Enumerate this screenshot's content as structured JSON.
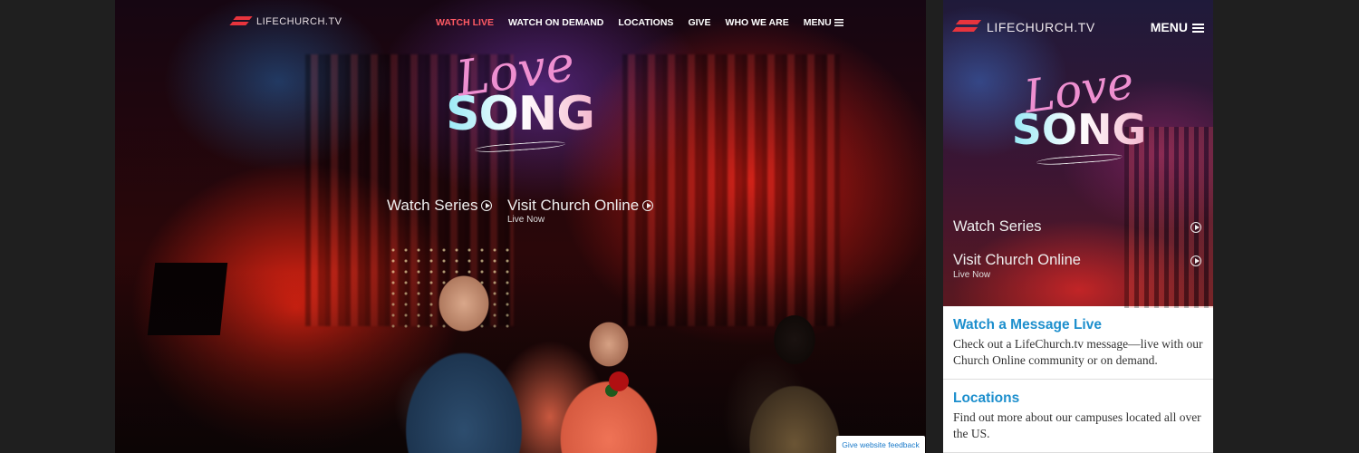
{
  "brand": {
    "logo_text": "LIFECHURCH.TV",
    "accent": "#e8343d"
  },
  "desktop": {
    "nav": [
      {
        "label": "WATCH LIVE",
        "active": true
      },
      {
        "label": "WATCH ON DEMAND"
      },
      {
        "label": "LOCATIONS"
      },
      {
        "label": "GIVE"
      },
      {
        "label": "WHO WE ARE"
      },
      {
        "label": "MENU"
      }
    ],
    "series_title": {
      "line1": "Love",
      "line2": "SONG"
    },
    "cta": {
      "watch_series": "Watch Series",
      "visit_online": "Visit Church Online",
      "visit_online_sub": "Live Now"
    },
    "feedback_label": "Give website feedback"
  },
  "mobile": {
    "logo_text": "LIFECHURCH.TV",
    "menu_label": "MENU",
    "series_title": {
      "line1": "Love",
      "line2": "SONG"
    },
    "watch_series": "Watch Series",
    "visit_online": "Visit Church Online",
    "visit_online_sub": "Live Now",
    "cards": [
      {
        "title": "Watch a Message Live",
        "body": "Check out a LifeChurch.tv message—live with our Church Online community or on demand."
      },
      {
        "title": "Locations",
        "body": "Find out more about our campuses located all over the US."
      }
    ],
    "link_color": "#1d8fcd"
  }
}
